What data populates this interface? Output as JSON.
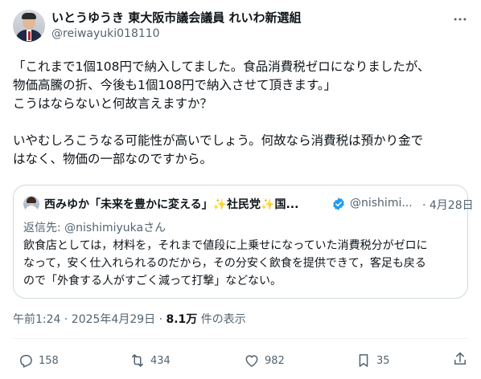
{
  "author": {
    "name": "いとうゆうき 東大阪市議会議員 れいわ新選組",
    "handle": "@reiwayuki018110"
  },
  "icons": {
    "more": "more-icon",
    "verified": "verified-badge-icon",
    "reply": "reply-icon",
    "repost": "repost-icon",
    "like": "like-icon",
    "bookmark": "bookmark-icon",
    "share": "share-icon"
  },
  "tweet": {
    "lines": [
      "「これまで1個108円で納入してました。食品消費税ゼロになりましたが、",
      "物価高騰の折、今後も1個108円で納入させて頂きます。」",
      "こうはならないと何故言えますか？",
      "いやむしろこうなる可能性が高いでしょう。何故なら消費税は預かり金で",
      "はなく、物価の一部なのですから。"
    ]
  },
  "quoted": {
    "name": "西みゆか「未来を豊かに変える」✨社民党✨国...",
    "handle": "@nishimi...",
    "date": "· 4月28日",
    "reply_prefix": "返信先: ",
    "reply_mention": "@nishimiyukaさん",
    "lines": [
      "飲食店としては，材料を，それまで値段に上乗せになっていた消費税分がゼロに",
      "なって，安く仕入れられるのだから，その分安く飲食を提供できて，客足も戻る",
      "ので「外食する人がすごく減って打撃」などない。"
    ]
  },
  "meta": {
    "time": "午前1:24 · 2025年4月29日 · ",
    "views": "8.1万",
    "views_label": " 件の表示"
  },
  "actions": {
    "replies": "158",
    "reposts": "434",
    "likes": "982",
    "bookmarks": "35"
  },
  "colors": {
    "text": "#0f1419",
    "secondary": "#536471",
    "border": "#cfd9de",
    "verified": "#1d9bf0"
  }
}
